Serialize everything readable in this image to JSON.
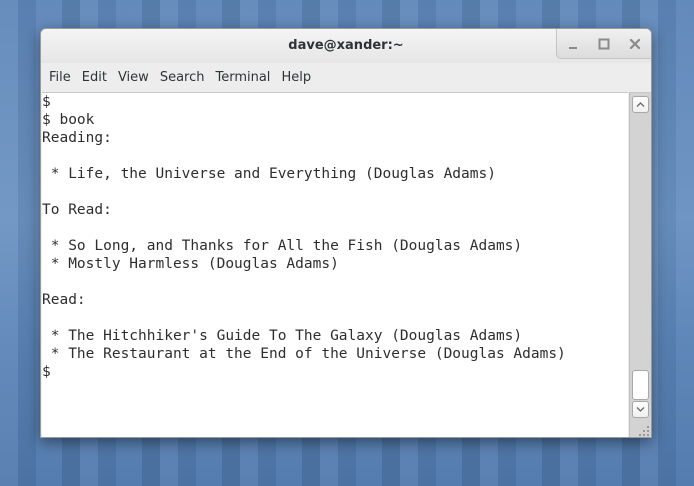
{
  "window": {
    "title": "dave@xander:~",
    "controls": [
      {
        "name": "minimize",
        "icon": "minimize-icon"
      },
      {
        "name": "maximize",
        "icon": "maximize-icon"
      },
      {
        "name": "close",
        "icon": "close-icon"
      }
    ]
  },
  "menubar": {
    "items": [
      {
        "label": "File"
      },
      {
        "label": "Edit"
      },
      {
        "label": "View"
      },
      {
        "label": "Search"
      },
      {
        "label": "Terminal"
      },
      {
        "label": "Help"
      }
    ]
  },
  "terminal": {
    "lines": [
      "$",
      "$ book",
      "Reading:",
      "",
      " * Life, the Universe and Everything (Douglas Adams)",
      "",
      "To Read:",
      "",
      " * So Long, and Thanks for All the Fish (Douglas Adams)",
      " * Mostly Harmless (Douglas Adams)",
      "",
      "Read:",
      "",
      " * The Hitchhiker's Guide To The Galaxy (Douglas Adams)",
      " * The Restaurant at the End of the Universe (Douglas Adams)",
      "$"
    ]
  },
  "scrollbar": {
    "up_icon": "chevron-up-icon",
    "down_icon": "chevron-down-icon",
    "position": 1.0
  },
  "colors": {
    "desktop": "#5d86b8",
    "terminal_bg": "#ffffff",
    "terminal_fg": "#2e2e2e"
  }
}
